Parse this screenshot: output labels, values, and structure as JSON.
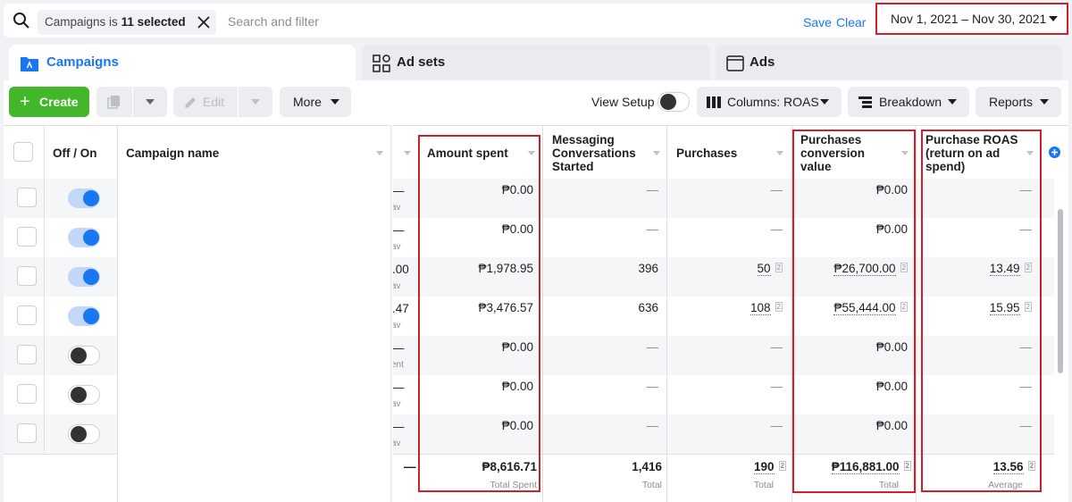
{
  "filter_bar": {
    "chip_field": "Campaigns is",
    "chip_value": "11 selected",
    "search_placeholder": "Search and filter",
    "save_label": "Save",
    "clear_label": "Clear",
    "date_range": "Nov 1, 2021 – Nov 30, 2021"
  },
  "tabs": [
    {
      "label": "Campaigns",
      "icon": "folder-icon",
      "active": true
    },
    {
      "label": "Ad sets",
      "icon": "grid-icon",
      "active": false
    },
    {
      "label": "Ads",
      "icon": "ad-window-icon",
      "active": false
    }
  ],
  "toolbar": {
    "create_label": "Create",
    "edit_label": "Edit",
    "more_label": "More",
    "view_setup_label": "View Setup",
    "view_setup_on": false,
    "columns_label": "Columns: ROAS",
    "breakdown_label": "Breakdown",
    "reports_label": "Reports"
  },
  "table": {
    "headers": {
      "off_on": "Off / On",
      "campaign_name": "Campaign name",
      "amount_spent": "Amount spent",
      "messaging": "Messaging Conversations Started",
      "purchases": "Purchases",
      "conversion_value": "Purchases conversion value",
      "roas": "Purchase ROAS (return on ad spend)"
    },
    "rows": [
      {
        "on": true,
        "cut_val": "—",
        "cut_sub": "av",
        "amount_spent": "₱0.00",
        "messaging": "—",
        "purchases": "—",
        "purchases_note": "",
        "conversion_value": "₱0.00",
        "conversion_note": "",
        "roas": "—",
        "roas_note": ""
      },
      {
        "on": true,
        "cut_val": "—",
        "cut_sub": "av",
        "amount_spent": "₱0.00",
        "messaging": "—",
        "purchases": "—",
        "purchases_note": "",
        "conversion_value": "₱0.00",
        "conversion_note": "",
        "roas": "—",
        "roas_note": ""
      },
      {
        "on": true,
        "cut_val": ".00",
        "cut_sub": "av",
        "amount_spent": "₱1,978.95",
        "messaging": "396",
        "purchases": "50",
        "purchases_note": "2",
        "conversion_value": "₱26,700.00",
        "conversion_note": "2",
        "roas": "13.49",
        "roas_note": "2"
      },
      {
        "on": true,
        "cut_val": ".47",
        "cut_sub": "av",
        "amount_spent": "₱3,476.57",
        "messaging": "636",
        "purchases": "108",
        "purchases_note": "2",
        "conversion_value": "₱55,444.00",
        "conversion_note": "2",
        "roas": "15.95",
        "roas_note": "2"
      },
      {
        "on": false,
        "cut_val": "—",
        "cut_sub": "ent",
        "amount_spent": "₱0.00",
        "messaging": "—",
        "purchases": "—",
        "purchases_note": "",
        "conversion_value": "₱0.00",
        "conversion_note": "",
        "roas": "—",
        "roas_note": ""
      },
      {
        "on": false,
        "cut_val": "—",
        "cut_sub": "av",
        "amount_spent": "₱0.00",
        "messaging": "—",
        "purchases": "—",
        "purchases_note": "",
        "conversion_value": "₱0.00",
        "conversion_note": "",
        "roas": "—",
        "roas_note": ""
      },
      {
        "on": false,
        "cut_val": "—",
        "cut_sub": "av",
        "amount_spent": "₱0.00",
        "messaging": "—",
        "purchases": "—",
        "purchases_note": "",
        "conversion_value": "₱0.00",
        "conversion_note": "",
        "roas": "—",
        "roas_note": ""
      }
    ],
    "totals": {
      "cut_val": "—",
      "amount_spent": "₱8,616.71",
      "amount_spent_sub": "Total Spent",
      "messaging": "1,416",
      "messaging_sub": "Total",
      "purchases": "190",
      "purchases_note": "2",
      "purchases_sub": "Total",
      "conversion_value": "₱116,881.00",
      "conversion_note": "2",
      "conversion_sub": "Total",
      "roas": "13.56",
      "roas_note": "2",
      "roas_sub": "Average"
    }
  },
  "colors": {
    "accent": "#1877f2",
    "create_green": "#42b72a",
    "highlight_red": "#d0202a"
  }
}
